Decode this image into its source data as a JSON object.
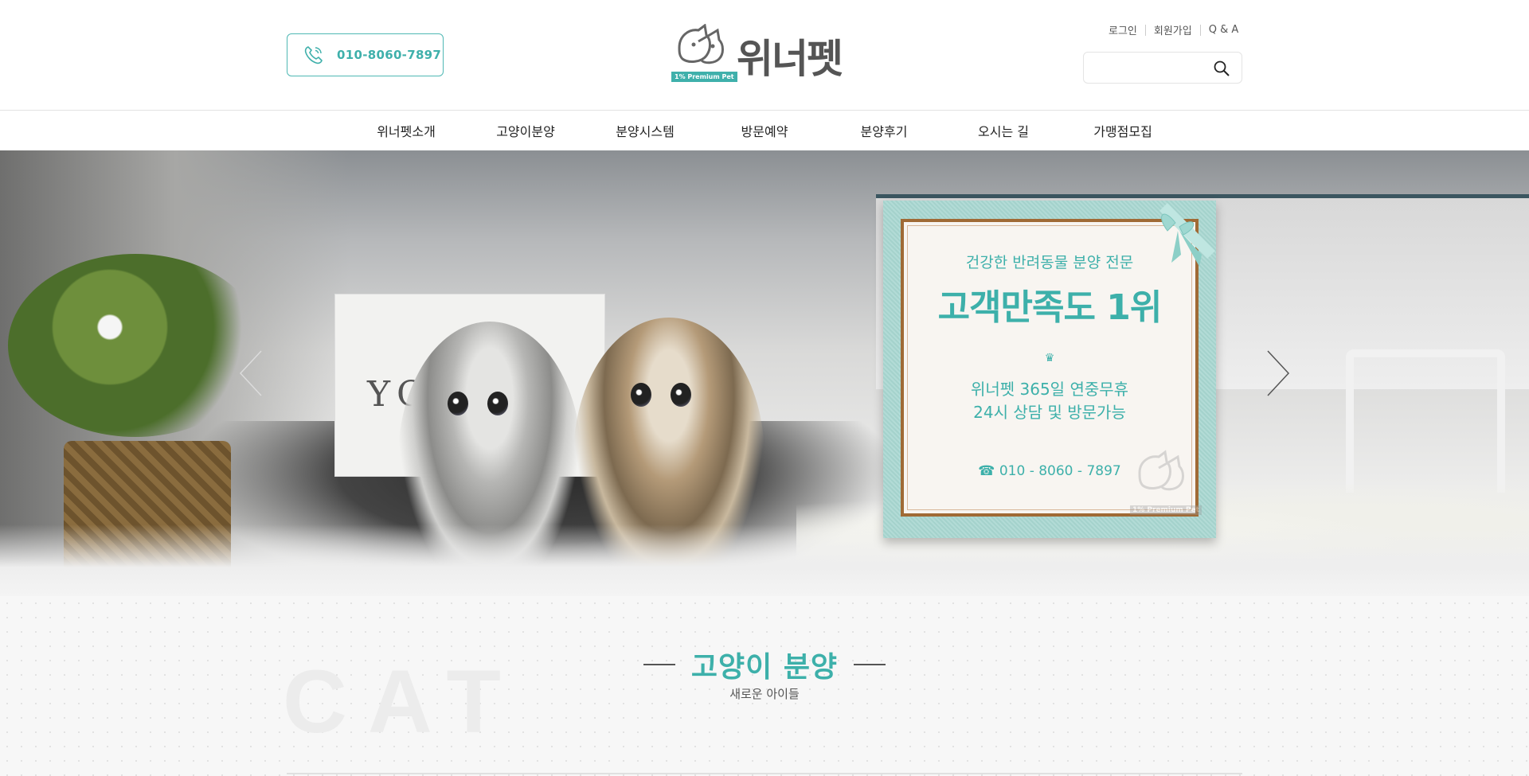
{
  "header": {
    "phone": "010-8060-7897",
    "brand": "위너펫",
    "badge": "1% Premium Pet",
    "links": {
      "login": "로그인",
      "signup": "회원가입",
      "qna": "Q & A"
    },
    "search": {
      "placeholder": ""
    }
  },
  "nav": {
    "items": [
      {
        "label": "위너펫소개"
      },
      {
        "label": "고양이분양"
      },
      {
        "label": "분양시스템"
      },
      {
        "label": "방문예약"
      },
      {
        "label": "분양후기"
      },
      {
        "label": "오시는 길"
      },
      {
        "label": "가맹점모집"
      }
    ]
  },
  "hero": {
    "book_text": "YO    E",
    "card": {
      "line1": "건강한 반려동물 분양 전문",
      "line2": "고객만족도 1위",
      "crown": "♛",
      "line3": "위너펫 365일 연중무휴",
      "line4": "24시 상담 및 방문가능",
      "phone": "☎  010 - 8060 - 7897",
      "watermark": "1% Premium Pet"
    }
  },
  "section": {
    "bg_word": "CAT",
    "title": "고양이 분양",
    "subtitle": "새로운 아이들"
  },
  "colors": {
    "accent": "#3db0aa",
    "card_bg": "#a7d6d0",
    "frame": "#a06a35"
  }
}
